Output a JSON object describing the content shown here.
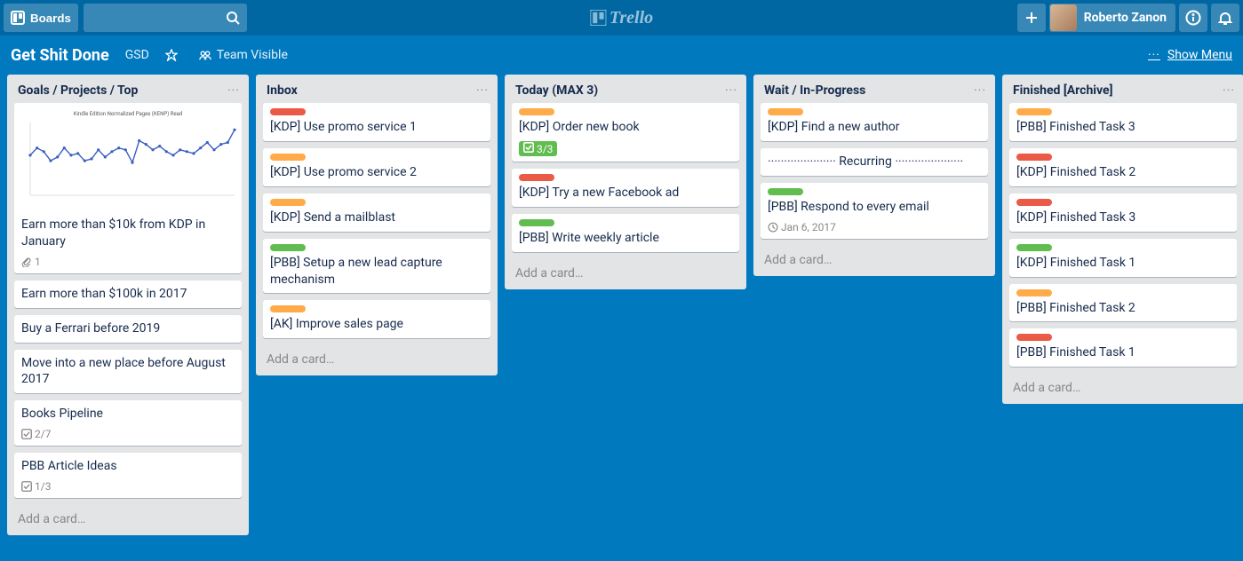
{
  "header": {
    "boards_label": "Boards",
    "logo_text": "Trello",
    "user_name": "Roberto Zanon"
  },
  "board": {
    "title": "Get Shit Done",
    "short_code": "GSD",
    "visibility": "Team Visible",
    "show_menu_label": "Show Menu"
  },
  "lists": [
    {
      "title": "Goals / Projects / Top",
      "add_label": "Add a card…",
      "cards": [
        {
          "title": "Earn more than $10k from KDP in January",
          "cover": true,
          "labels": [],
          "badges": [
            {
              "type": "attachment",
              "text": "1"
            }
          ]
        },
        {
          "title": "Earn more than $100k in 2017",
          "labels": [],
          "badges": []
        },
        {
          "title": "Buy a Ferrari before 2019",
          "labels": [],
          "badges": []
        },
        {
          "title": "Move into a new place before August 2017",
          "labels": [],
          "badges": []
        },
        {
          "title": "Books Pipeline",
          "labels": [],
          "badges": [
            {
              "type": "checklist",
              "text": "2/7"
            }
          ]
        },
        {
          "title": "PBB Article Ideas",
          "labels": [],
          "badges": [
            {
              "type": "checklist",
              "text": "1/3"
            }
          ]
        }
      ]
    },
    {
      "title": "Inbox",
      "add_label": "Add a card…",
      "cards": [
        {
          "title": "[KDP] Use promo service 1",
          "labels": [
            "red"
          ],
          "badges": []
        },
        {
          "title": "[KDP] Use promo service 2",
          "labels": [
            "orange"
          ],
          "badges": []
        },
        {
          "title": "[KDP] Send a mailblast",
          "labels": [
            "orange"
          ],
          "badges": []
        },
        {
          "title": "[PBB] Setup a new lead capture mechanism",
          "labels": [
            "green"
          ],
          "badges": []
        },
        {
          "title": "[AK] Improve sales page",
          "labels": [
            "orange"
          ],
          "badges": []
        }
      ]
    },
    {
      "title": "Today (MAX 3)",
      "add_label": "Add a card…",
      "cards": [
        {
          "title": "[KDP] Order new book",
          "labels": [
            "orange"
          ],
          "badges": [
            {
              "type": "checklist-complete",
              "text": "3/3"
            }
          ]
        },
        {
          "title": "[KDP] Try a new Facebook ad",
          "labels": [
            "red"
          ],
          "badges": []
        },
        {
          "title": "[PBB] Write weekly article",
          "labels": [
            "green"
          ],
          "badges": []
        }
      ]
    },
    {
      "title": "Wait / In-Progress",
      "add_label": "Add a card…",
      "cards": [
        {
          "title": "[KDP] Find a new author",
          "labels": [
            "orange"
          ],
          "badges": []
        },
        {
          "title": "····················· Recurring ·····················",
          "labels": [],
          "badges": []
        },
        {
          "title": "[PBB] Respond to every email",
          "labels": [
            "green"
          ],
          "badges": [
            {
              "type": "due",
              "text": "Jan 6, 2017"
            }
          ]
        }
      ]
    },
    {
      "title": "Finished [Archive]",
      "add_label": "Add a card…",
      "cards": [
        {
          "title": "[PBB] Finished Task 3",
          "labels": [
            "orange"
          ],
          "badges": []
        },
        {
          "title": "[KDP] Finished Task 2",
          "labels": [
            "red"
          ],
          "badges": []
        },
        {
          "title": "[KDP] Finished Task 3",
          "labels": [
            "red"
          ],
          "badges": []
        },
        {
          "title": "[KDP] Finished Task 1",
          "labels": [
            "green"
          ],
          "badges": []
        },
        {
          "title": "[PBB] Finished Task 2",
          "labels": [
            "orange"
          ],
          "badges": []
        },
        {
          "title": "[PBB] Finished Task 1",
          "labels": [
            "red"
          ],
          "badges": []
        }
      ]
    }
  ],
  "chart_data": {
    "type": "line",
    "title": "Kindle Edition Normalized Pages (KENP) Read",
    "x": [
      1,
      2,
      3,
      4,
      5,
      6,
      7,
      8,
      9,
      10,
      11,
      12,
      13,
      14,
      15,
      16,
      17,
      18,
      19,
      20,
      21,
      22,
      23,
      24,
      25,
      26,
      27,
      28,
      29,
      30,
      31
    ],
    "series": [
      {
        "name": "KENP",
        "values": [
          2200,
          2600,
          2400,
          1900,
          2100,
          2600,
          2200,
          2300,
          1900,
          2000,
          2500,
          2100,
          2400,
          2600,
          2500,
          1800,
          3000,
          2800,
          2500,
          2700,
          2400,
          2200,
          2500,
          2400,
          2300,
          2600,
          2900,
          2500,
          2800,
          2900,
          3600
        ]
      }
    ],
    "ylim": [
      0,
      4000
    ]
  }
}
